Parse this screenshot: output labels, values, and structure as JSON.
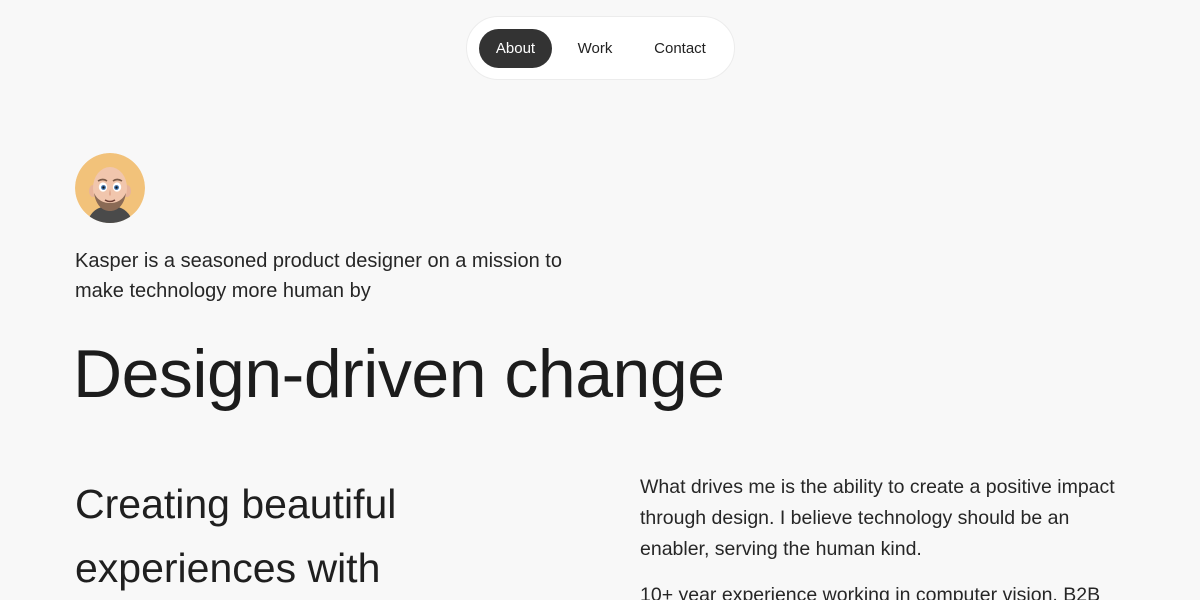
{
  "nav": {
    "items": [
      {
        "label": "About",
        "active": true
      },
      {
        "label": "Work",
        "active": false
      },
      {
        "label": "Contact",
        "active": false
      }
    ]
  },
  "hero": {
    "intro": "Kasper is a seasoned product designer on a mission to make technology more human by",
    "headline": "Design-driven change"
  },
  "section": {
    "subhead": "Creating beautiful experiences with",
    "paragraphs": [
      "What drives me is the ability to create a positive impact through design. I believe technology should be an enabler, serving the human kind.",
      "10+ year experience working in computer vision, B2B"
    ]
  },
  "colors": {
    "background": "#f8f8f8",
    "nav_active_bg": "#333333",
    "text": "#1f1f1f"
  }
}
